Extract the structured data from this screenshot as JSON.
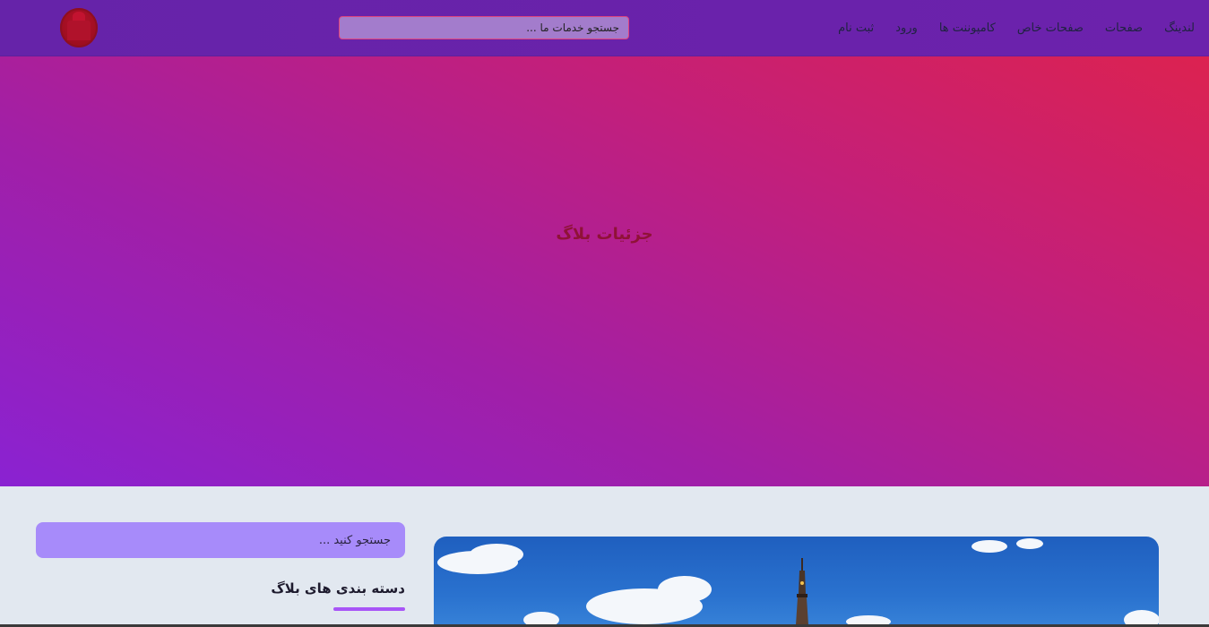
{
  "header": {
    "nav": [
      {
        "label": "لندینگ"
      },
      {
        "label": "صفحات"
      },
      {
        "label": "صفحات خاص"
      },
      {
        "label": "کامپوننت ها"
      },
      {
        "label": "ورود"
      },
      {
        "label": "ثبت نام"
      }
    ],
    "search": {
      "placeholder": "جستجو خدمات ما ..."
    },
    "logo_icon": "mosque-logo-icon"
  },
  "hero": {
    "title": "جزئیات بلاگ"
  },
  "sidebar": {
    "search": {
      "placeholder": "جستجو کنید ..."
    },
    "categories_title": "دسته بندی های بلاگ"
  },
  "colors": {
    "header_bg": "#6b21a8",
    "hero_gradient_start": "#8a22d2",
    "hero_gradient_end": "#dc2250",
    "accent": "#a855f7",
    "sidebar_search_bg": "#a78bfa",
    "page_bg": "#e2e8f0"
  }
}
